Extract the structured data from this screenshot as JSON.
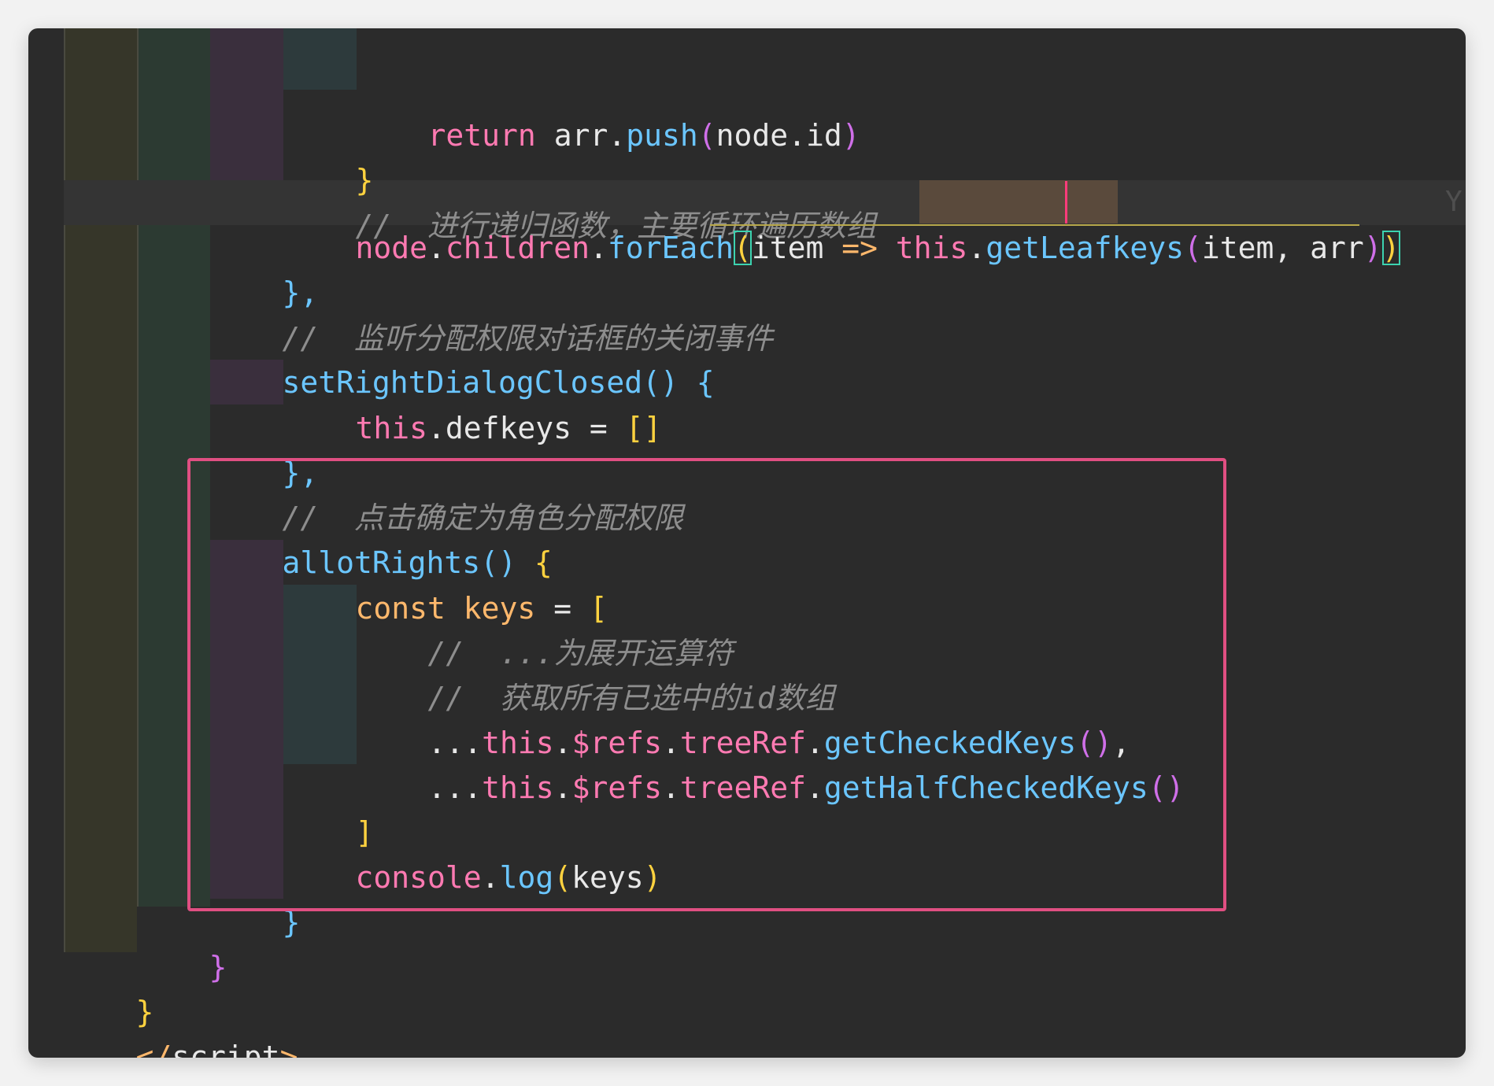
{
  "editor": {
    "lines": {
      "l1": {
        "kw": "return",
        "obj": "arr",
        "dot": ".",
        "fn": "push",
        "open": "(",
        "arg": "node",
        "dot2": ".",
        "prop": "id",
        "close": ")"
      },
      "l2": {
        "brace": "}"
      },
      "l3": {
        "comment": "//  进行递归函数，主要循环遍历数组"
      },
      "l4": {
        "obj": "node",
        "dot": ".",
        "prop": "children",
        "dot2": ".",
        "fn": "forEach",
        "open": "(",
        "param": "item",
        "arrow": " => ",
        "thiskw": "this",
        "dot3": ".",
        "fn2": "getLeafkeys",
        "open2": "(",
        "args": "item, arr",
        "close2": ")",
        "close": ")"
      },
      "l5": {
        "text": "},"
      },
      "l6": {
        "comment": "//  监听分配权限对话框的关闭事件"
      },
      "l7": {
        "fn": "setRightDialogClosed",
        "parens": "()",
        "brace": " {"
      },
      "l8": {
        "thiskw": "this",
        "rest": ".defkeys = ",
        "arr": "[]"
      },
      "l9": {
        "text": "},"
      },
      "l10": {
        "comment": "//  点击确定为角色分配权限"
      },
      "l11": {
        "fn": "allotRights",
        "parens": "()",
        "brace": " {"
      },
      "l12": {
        "kw": "const",
        "name": "keys",
        "eq": " = ",
        "open": "["
      },
      "l13": {
        "comment": "//  ...为展开运算符"
      },
      "l14": {
        "comment": "//  获取所有已选中的id数组"
      },
      "l15": {
        "spread": "...",
        "thiskw": "this",
        "dot": ".",
        "refs": "$refs",
        "dot2": ".",
        "tree": "treeRef",
        "dot3": ".",
        "fn": "getCheckedKeys",
        "parens": "()",
        "tail": ","
      },
      "l16": {
        "spread": "...",
        "thiskw": "this",
        "dot": ".",
        "refs": "$refs",
        "dot2": ".",
        "tree": "treeRef",
        "dot3": ".",
        "fn": "getHalfCheckedKeys",
        "parens": "()"
      },
      "l17": {
        "close": "]"
      },
      "l18": {
        "obj": "console",
        "dot": ".",
        "fn": "log",
        "open": "(",
        "arg": "keys",
        "close": ")"
      },
      "l19": {
        "brace": "}"
      },
      "l20": {
        "brace": "}"
      },
      "l21": {
        "brace": "}"
      },
      "l22": {
        "lt": "</",
        "tag": "script",
        "gt": ">"
      }
    },
    "codelens": "Y",
    "colors": {
      "background": "#2b2b2b",
      "keyword": "#ff7ab2",
      "function": "#6bc6ff",
      "bracket": "#ffd23f",
      "comment": "#8d8d8d",
      "highlight_box": "#e04f82"
    }
  }
}
